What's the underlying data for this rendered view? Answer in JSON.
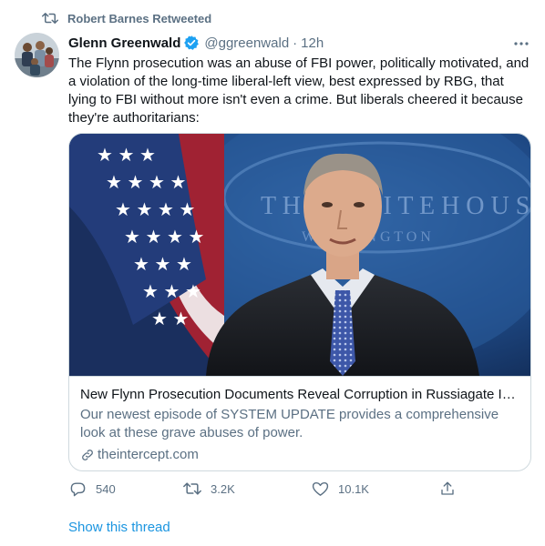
{
  "retweet_banner": {
    "text": "Robert Barnes Retweeted",
    "icon": "retweet-icon"
  },
  "tweet": {
    "author_name": "Glenn Greenwald",
    "verified": true,
    "handle": "@ggreenwald",
    "separator": "·",
    "time": "12h",
    "text": "The Flynn prosecution was an abuse of FBI power, politically motivated, and a violation of the long-time liberal-left view, best expressed by RBG, that lying to FBI without more isn't even a crime. But liberals cheered it because they're authoritarians:",
    "card": {
      "image": "press-conference-photo",
      "title": "New Flynn Prosecution Documents Reveal Corruption in Russiagate Inve...",
      "description": "Our newest episode of SYSTEM UPDATE provides a comprehensive look at these grave abuses of power.",
      "domain": "theintercept.com"
    },
    "actions": {
      "reply_count": "540",
      "retweet_count": "3.2K",
      "like_count": "10.1K"
    }
  },
  "show_thread": "Show this thread",
  "colors": {
    "accent": "#1da1f2",
    "link": "#1b95e0",
    "secondary_text": "#5b7083",
    "primary_text": "#0f1419"
  }
}
